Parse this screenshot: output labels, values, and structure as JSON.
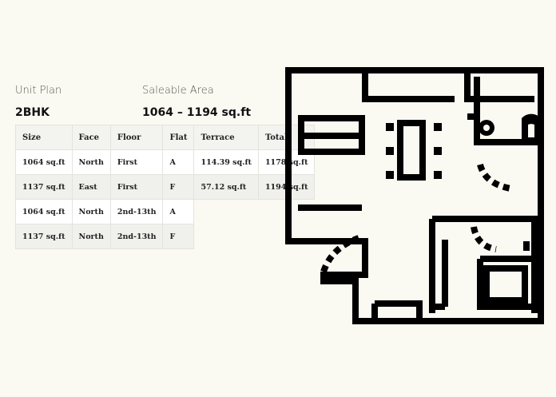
{
  "unit_plan": {
    "label": "Unit Plan",
    "value": "2BHK"
  },
  "saleable_area": {
    "label": "Saleable Area",
    "value": "1064 – 1194 sq.ft"
  },
  "table": {
    "headers": [
      "Size",
      "Face",
      "Floor",
      "Flat",
      "Terrace",
      "Total"
    ],
    "rows": [
      [
        "1064 sq.ft",
        "North",
        "First",
        "A",
        "114.39 sq.ft",
        "1178 sq.ft"
      ],
      [
        "1137 sq.ft",
        "East",
        "First",
        "F",
        "57.12 sq.ft",
        "1194 sq.ft"
      ],
      [
        "1064 sq.ft",
        "North",
        "2nd-13th",
        "A",
        "",
        ""
      ],
      [
        "1137 sq.ft",
        "North",
        "2nd-13th",
        "F",
        "",
        ""
      ]
    ]
  },
  "floor_plan": {
    "icon": "floor-plan-icon",
    "color": "#000000"
  }
}
